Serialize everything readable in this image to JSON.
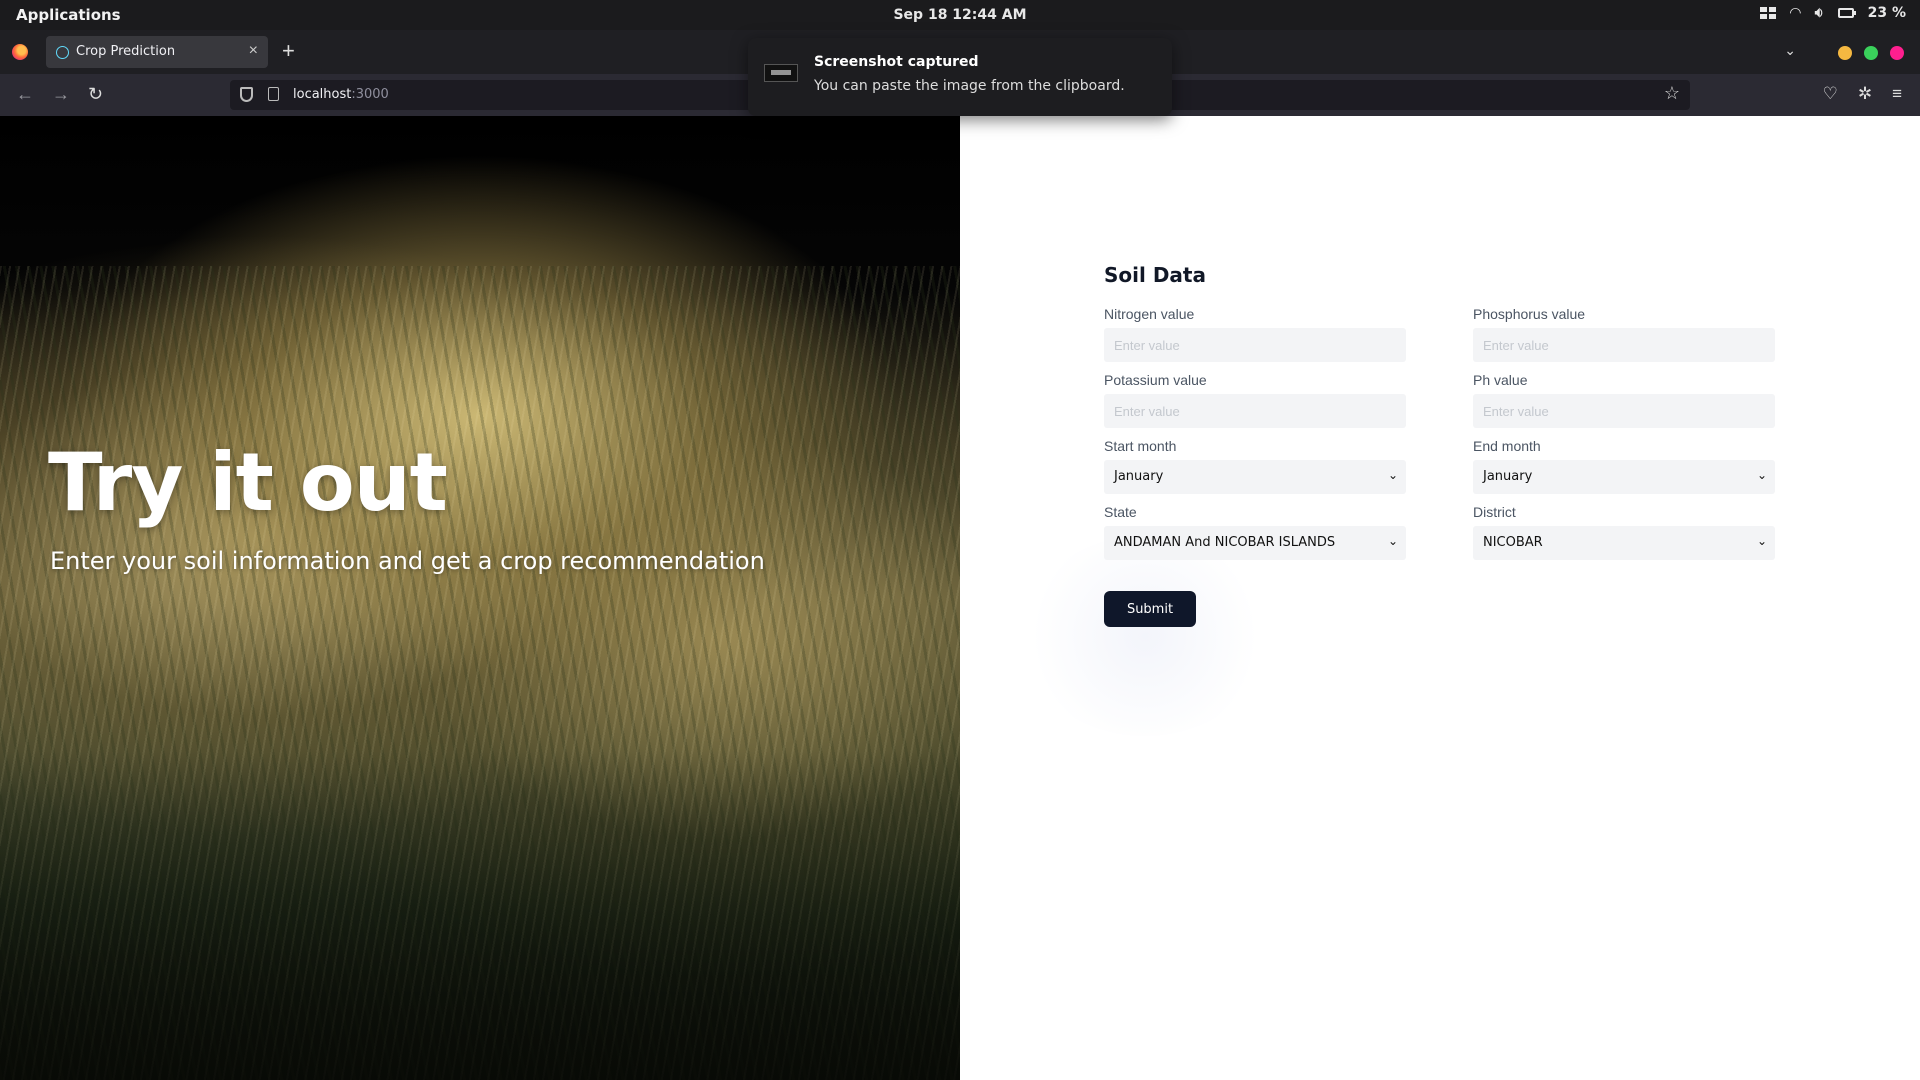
{
  "system": {
    "apps_label": "Applications",
    "clock": "Sep 18  12:44 AM",
    "battery": "23 %"
  },
  "browser": {
    "tab_title": "Crop Prediction",
    "new_tab": "+",
    "url_host": "localhost",
    "url_port": ":3000"
  },
  "notification": {
    "title": "Screenshot captured",
    "body": "You can paste the image from the clipboard."
  },
  "hero": {
    "title": "Try it out",
    "subtitle": "Enter your soil information and get a crop recommendation"
  },
  "form": {
    "title": "Soil Data",
    "nitrogen": {
      "label": "Nitrogen value",
      "placeholder": "Enter value",
      "value": ""
    },
    "phosphorus": {
      "label": "Phosphorus value",
      "placeholder": "Enter value",
      "value": ""
    },
    "potassium": {
      "label": "Potassium value",
      "placeholder": "Enter value",
      "value": ""
    },
    "ph": {
      "label": "Ph value",
      "placeholder": "Enter value",
      "value": ""
    },
    "start_month": {
      "label": "Start month",
      "selected": "January"
    },
    "end_month": {
      "label": "End month",
      "selected": "January"
    },
    "state": {
      "label": "State",
      "selected": "ANDAMAN And NICOBAR ISLANDS"
    },
    "district": {
      "label": "District",
      "selected": "NICOBAR"
    },
    "submit_label": "Submit"
  },
  "colors": {
    "primary_button": "#0f172a",
    "input_bg": "#f3f4f6",
    "close_dot": "#f5b841",
    "min_dot": "#3ad15b",
    "max_dot": "#ff1f8f"
  }
}
